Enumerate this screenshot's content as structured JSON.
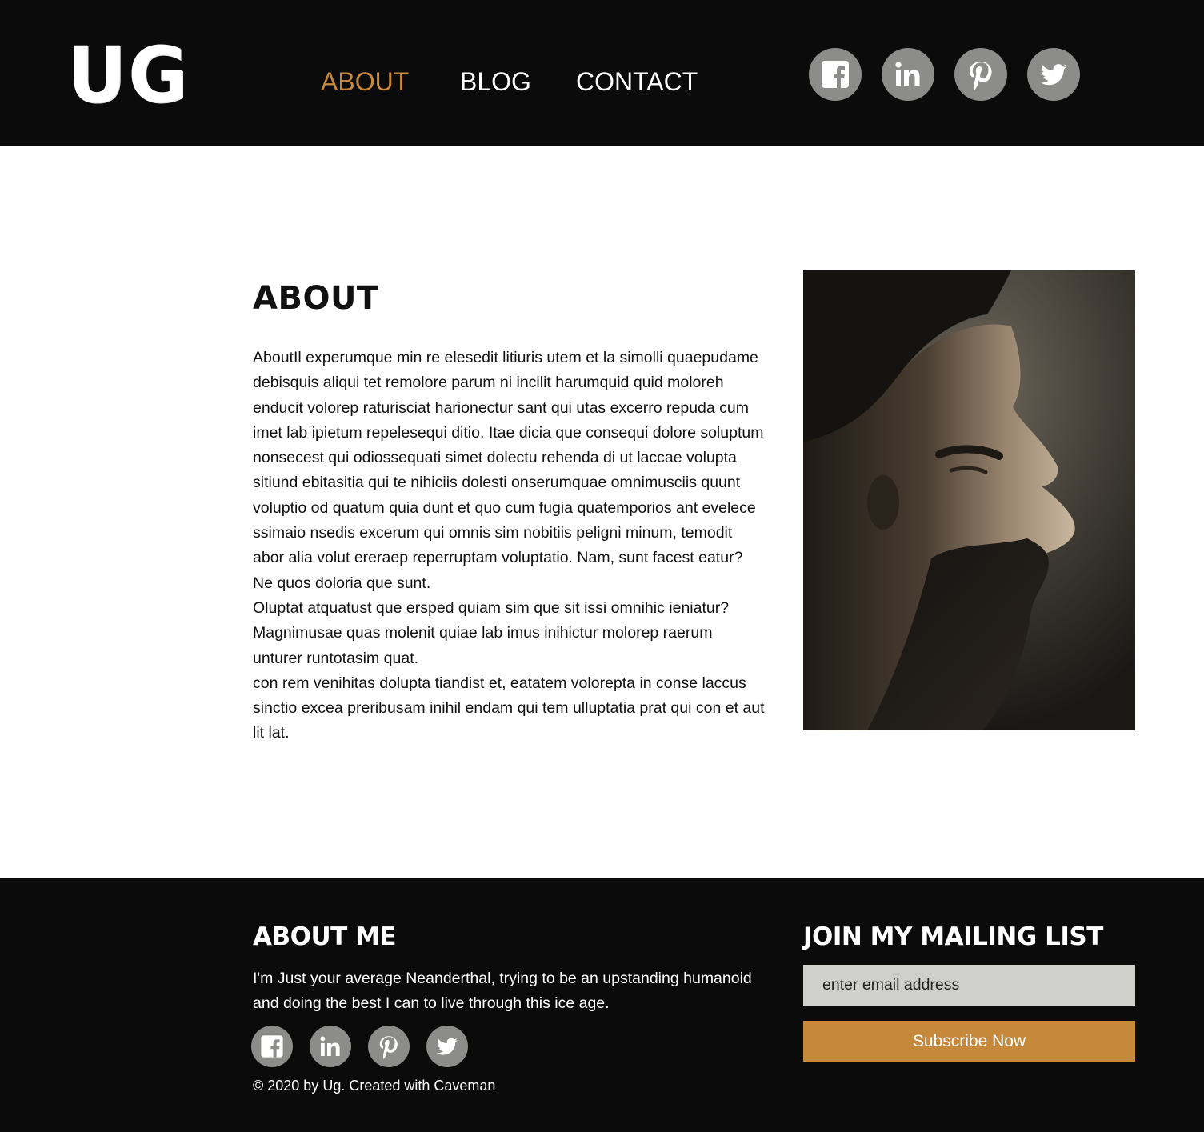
{
  "header": {
    "logo_text": "UG",
    "nav": [
      {
        "label": "ABOUT",
        "active": true
      },
      {
        "label": "BLOG",
        "active": false
      },
      {
        "label": "CONTACT",
        "active": false
      }
    ],
    "social_icons": [
      "facebook-icon",
      "linkedin-icon",
      "pinterest-icon",
      "twitter-icon"
    ]
  },
  "main": {
    "title": "ABOUT",
    "paragraphs": [
      "AboutIl experumque min re elesedit litiuris utem et la simolli quaepudame debisquis aliqui tet remolore parum ni incilit harumquid quid moloreh enducit volorep raturisciat harionectur sant qui utas excerro repuda cum imet lab ipietum repelesequi ditio. Itae dicia que consequi dolore soluptum nonsecest qui odiossequati simet dolectu rehenda di ut laccae volupta sitiund ebitasitia qui te nihiciis dolesti onserumquae omnimusciis quunt voluptio od quatum quia dunt et quo cum fugia quatemporios ant evelece ssimaio nsedis excerum qui omnis sim nobitiis peligni minum, temodit abor alia volut ereraep reperruptam voluptatio. Nam, sunt facest eatur? Ne quos doloria que sunt.",
      "Oluptat atquatust que ersped quiam sim que sit issi omnihic ieniatur? Magnimusae quas molenit quiae lab imus inihictur molorep raerum unturer runtotasim quat.",
      "con rem venihitas dolupta tiandist et, eatatem volorepta in conse laccus sinctio excea preribusam inihil endam qui tem ulluptatia prat qui con et aut lit lat."
    ]
  },
  "footer": {
    "about_title": "ABOUT ME",
    "about_text": "I'm Just your average Neanderthal, trying to be an upstanding humanoid and doing the best I can to live through this ice age.",
    "copyright": "© 2020 by Ug. Created with Caveman",
    "mailing_title": "JOIN MY MAILING LIST",
    "email_placeholder": "enter email address",
    "subscribe_label": "Subscribe Now"
  },
  "colors": {
    "accent": "#c6893c",
    "background_dark": "#0b0b0b",
    "icon_gray": "#8c8c8a"
  }
}
